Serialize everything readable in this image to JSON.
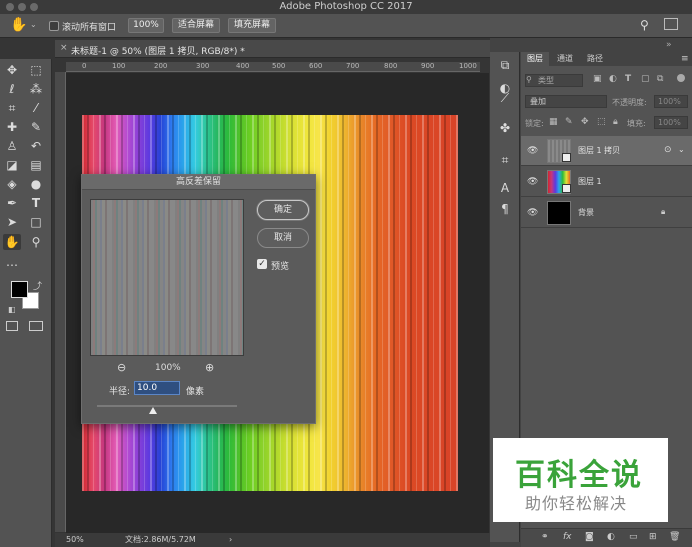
{
  "window": {
    "title": "Adobe Photoshop CC 2017"
  },
  "options_bar": {
    "scroll_all_label": "滚动所有窗口",
    "zoom_button": "100%",
    "fit_screen_button": "适合屏幕",
    "fill_screen_button": "填充屏幕"
  },
  "document": {
    "tab_title": "未标题-1 @ 50% (图层 1 拷贝, RGB/8*) *",
    "ruler_marks": [
      "0",
      "100",
      "200",
      "300",
      "400",
      "500",
      "600",
      "700",
      "800",
      "900",
      "1000"
    ],
    "zoom_status": "50%",
    "doc_status": "文档:2.86M/5.72M"
  },
  "dialog": {
    "title": "高反差保留",
    "ok": "确定",
    "cancel": "取消",
    "preview_label": "预览",
    "preview_checked": true,
    "zoom_value": "100%",
    "radius_label": "半径:",
    "radius_value": "10.0",
    "unit": "像素",
    "slider_position": 0.4
  },
  "layers_panel": {
    "tabs": [
      "图层",
      "通道",
      "路径"
    ],
    "filter_label": "类型",
    "blend_mode": "叠加",
    "opacity_label": "不透明度:",
    "opacity_value": "100%",
    "lock_label": "锁定:",
    "fill_label": "填充:",
    "fill_value": "100%",
    "layers": [
      {
        "name": "图层 1 拷贝"
      },
      {
        "name": "图层 1"
      },
      {
        "name": "背景"
      }
    ]
  },
  "watermark": {
    "main": "百科全说",
    "sub": "助你轻松解决"
  },
  "colors": {
    "accent": "#1f6fd0",
    "watermark_green": "#3aa33a"
  }
}
